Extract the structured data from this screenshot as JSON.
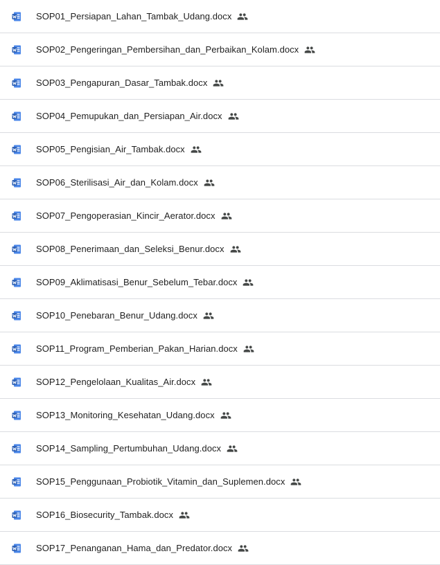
{
  "files": [
    {
      "name": "SOP01_Persiapan_Lahan_Tambak_Udang.docx",
      "icon": "word-doc-icon",
      "shared_icon": "people-icon"
    },
    {
      "name": "SOP02_Pengeringan_Pembersihan_dan_Perbaikan_Kolam.docx",
      "icon": "word-doc-icon",
      "shared_icon": "people-icon"
    },
    {
      "name": "SOP03_Pengapuran_Dasar_Tambak.docx",
      "icon": "word-doc-icon",
      "shared_icon": "people-icon"
    },
    {
      "name": "SOP04_Pemupukan_dan_Persiapan_Air.docx",
      "icon": "word-doc-icon",
      "shared_icon": "people-icon"
    },
    {
      "name": "SOP05_Pengisian_Air_Tambak.docx",
      "icon": "word-doc-icon",
      "shared_icon": "people-icon"
    },
    {
      "name": "SOP06_Sterilisasi_Air_dan_Kolam.docx",
      "icon": "word-doc-icon",
      "shared_icon": "people-icon"
    },
    {
      "name": "SOP07_Pengoperasian_Kincir_Aerator.docx",
      "icon": "word-doc-icon",
      "shared_icon": "people-icon"
    },
    {
      "name": "SOP08_Penerimaan_dan_Seleksi_Benur.docx",
      "icon": "word-doc-icon",
      "shared_icon": "people-icon"
    },
    {
      "name": "SOP09_Aklimatisasi_Benur_Sebelum_Tebar.docx",
      "icon": "word-doc-icon",
      "shared_icon": "people-icon"
    },
    {
      "name": "SOP10_Penebaran_Benur_Udang.docx",
      "icon": "word-doc-icon",
      "shared_icon": "people-icon"
    },
    {
      "name": "SOP11_Program_Pemberian_Pakan_Harian.docx",
      "icon": "word-doc-icon",
      "shared_icon": "people-icon"
    },
    {
      "name": "SOP12_Pengelolaan_Kualitas_Air.docx",
      "icon": "word-doc-icon",
      "shared_icon": "people-icon"
    },
    {
      "name": "SOP13_Monitoring_Kesehatan_Udang.docx",
      "icon": "word-doc-icon",
      "shared_icon": "people-icon"
    },
    {
      "name": "SOP14_Sampling_Pertumbuhan_Udang.docx",
      "icon": "word-doc-icon",
      "shared_icon": "people-icon"
    },
    {
      "name": "SOP15_Penggunaan_Probiotik_Vitamin_dan_Suplemen.docx",
      "icon": "word-doc-icon",
      "shared_icon": "people-icon"
    },
    {
      "name": "SOP16_Biosecurity_Tambak.docx",
      "icon": "word-doc-icon",
      "shared_icon": "people-icon"
    },
    {
      "name": "SOP17_Penanganan_Hama_dan_Predator.docx",
      "icon": "word-doc-icon",
      "shared_icon": "people-icon"
    }
  ],
  "colors": {
    "word_blue": "#2b5fb5",
    "word_light": "#4a86e8",
    "text": "#1f1f1f",
    "shared_icon": "#444746",
    "divider": "#dadce0"
  }
}
